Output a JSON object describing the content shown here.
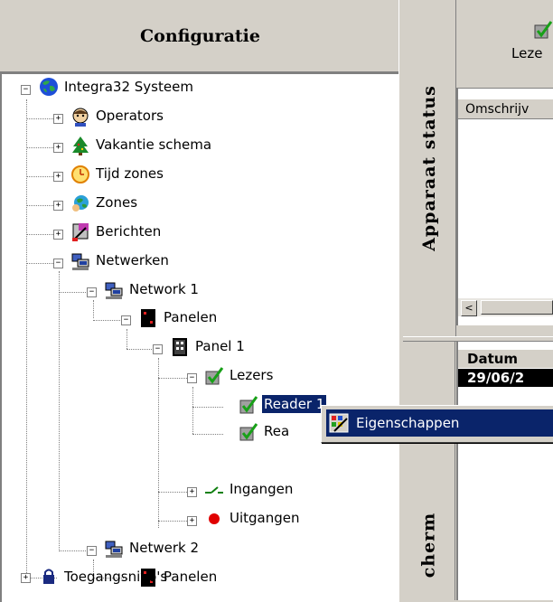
{
  "config_panel": {
    "title": "Configuratie"
  },
  "tree": {
    "root": {
      "label": "Integra32 Systeem",
      "expander": "−"
    },
    "operators": {
      "label": "Operators",
      "expander": "+"
    },
    "vakantie": {
      "label": "Vakantie schema",
      "expander": "+"
    },
    "tijd": {
      "label": "Tijd zones",
      "expander": "+"
    },
    "zones": {
      "label": "Zones",
      "expander": "+"
    },
    "berichten": {
      "label": "Berichten",
      "expander": "+"
    },
    "netwerken": {
      "label": "Netwerken",
      "expander": "−"
    },
    "network1": {
      "label": "Network 1",
      "expander": "−"
    },
    "panelen1": {
      "label": "Panelen",
      "expander": "−"
    },
    "panel1": {
      "label": "Panel 1",
      "expander": "−"
    },
    "lezers": {
      "label": "Lezers",
      "expander": "−"
    },
    "reader1": {
      "label": "Reader 1"
    },
    "reader2": {
      "label": "Rea"
    },
    "ingangen": {
      "label": "Ingangen",
      "expander": "+"
    },
    "uitgangen": {
      "label": "Uitgangen",
      "expander": "+"
    },
    "netwerk2": {
      "label": "Netwerk 2",
      "expander": "−"
    },
    "panelen2": {
      "label": "Panelen"
    },
    "toegang": {
      "label": "Toegangsnivo's",
      "expander": "+"
    }
  },
  "right": {
    "apparaat_tab": "Apparaat status",
    "lezers_button": "Leze",
    "list_column": "Omschrijv",
    "scroll_left": "<",
    "datum_header": "Datum",
    "datum_value": "29/06/2",
    "bottom_tab": "cherm"
  },
  "context_menu": {
    "item": "Eigenschappen"
  },
  "colors": {
    "selection": "#0a246a",
    "face": "#d4d0c8"
  }
}
